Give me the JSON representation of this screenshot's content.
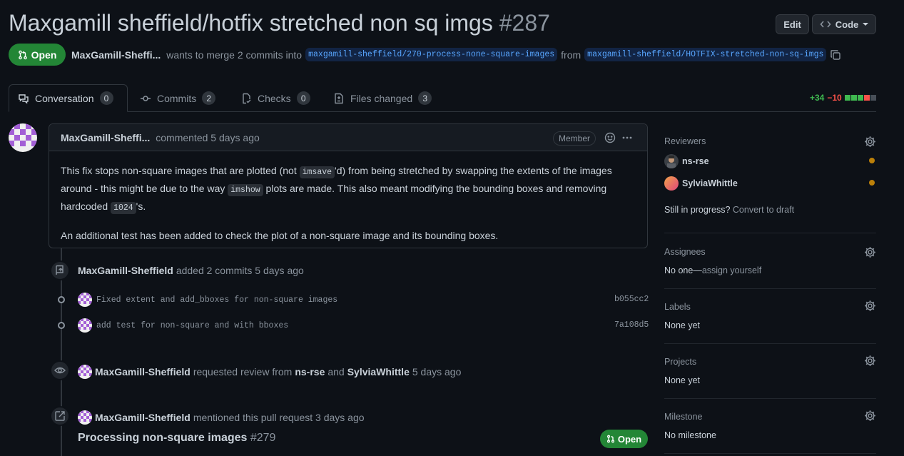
{
  "header": {
    "title": "Maxgamill sheffield/hotfix stretched non sq imgs",
    "number": "#287",
    "edit_label": "Edit",
    "code_label": "Code",
    "state": "Open",
    "author": "MaxGamill-Sheffi...",
    "merge_text": "wants to merge 2 commits into",
    "base_branch": "maxgamill-sheffield/270-process-none-square-images",
    "from_text": "from",
    "head_branch": "maxgamill-sheffield/HOTFIX-stretched-non-sq-imgs"
  },
  "tabs": [
    {
      "label": "Conversation",
      "count": "0"
    },
    {
      "label": "Commits",
      "count": "2"
    },
    {
      "label": "Checks",
      "count": "0"
    },
    {
      "label": "Files changed",
      "count": "3"
    }
  ],
  "diffstat": {
    "additions": "+34",
    "deletions": "−10"
  },
  "comment": {
    "author": "MaxGamill-Sheffi...",
    "action": "commented 5 days ago",
    "role": "Member",
    "p1_a": "This fix stops non-square images that are plotted (not ",
    "p1_code1": "imsave",
    "p1_b": "'d) from being stretched by swapping the extents of the images around - this might be due to the way ",
    "p1_code2": "imshow",
    "p1_c": " plots are made. This also meant modifying the bounding boxes and removing hardcoded ",
    "p1_code3": "1024",
    "p1_d": "'s.",
    "p2": "An additional test has been added to check the plot of a non-square image and its bounding boxes."
  },
  "commits_event": {
    "user": "MaxGamill-Sheffield",
    "text": "added 2 commits 5 days ago",
    "commits": [
      {
        "message": "Fixed extent and add_bboxes for non-square images",
        "sha": "b055cc2"
      },
      {
        "message": "add test for non-square and with bboxes",
        "sha": "7a108d5"
      }
    ]
  },
  "review_event": {
    "user": "MaxGamill-Sheffield",
    "text1": "requested review from",
    "reviewer1": "ns-rse",
    "and": "and",
    "reviewer2": "SylviaWhittle",
    "time": "5 days ago"
  },
  "mention_event": {
    "user": "MaxGamill-Sheffield",
    "text": "mentioned this pull request 3 days ago",
    "ref_title": "Processing non-square images",
    "ref_number": "#279",
    "ref_state": "Open"
  },
  "sidebar": {
    "reviewers_label": "Reviewers",
    "reviewers": [
      {
        "name": "ns-rse"
      },
      {
        "name": "SylviaWhittle"
      }
    ],
    "progress_text": "Still in progress?",
    "convert_link": "Convert to draft",
    "assignees_label": "Assignees",
    "assignees_none": "No one—",
    "assign_link": "assign yourself",
    "labels_label": "Labels",
    "labels_value": "None yet",
    "projects_label": "Projects",
    "projects_value": "None yet",
    "milestone_label": "Milestone",
    "milestone_value": "No milestone"
  },
  "colors": {
    "open_green": "#238636",
    "link_blue": "#58a6ff",
    "pending_dot": "#bb8009",
    "add": "#3fb950",
    "del": "#f85149"
  }
}
